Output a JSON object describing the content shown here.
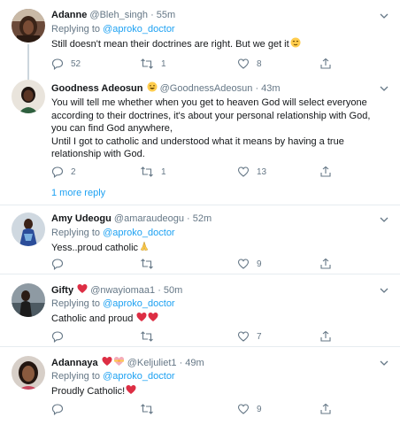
{
  "replying_prefix": "Replying to",
  "tweets": [
    {
      "name": "Adanne",
      "handle": "@Bleh_singh",
      "time": "· 55m",
      "reply_to": "@aproko_doctor",
      "text": "Still doesn't mean their doctrines are right. But we get it",
      "text_emoji": "relieved-face",
      "replies": "52",
      "retweets": "1",
      "likes": "8"
    },
    {
      "name": "Goodness Adeosun",
      "name_emoji": "grinning-face",
      "handle": "@GoodnessAdeosun",
      "time": "· 43m",
      "text_lines": [
        "You will tell me whether when you get to heaven God will select everyone",
        "according to their doctrines, it's about your personal relationship with God,",
        "you can find God anywhere,",
        "Until I got to catholic and understood what it means by having a true",
        "relationship with God."
      ],
      "replies": "2",
      "retweets": "1",
      "likes": "13"
    },
    {
      "name": "Amy Udeogu",
      "handle": "@amaraudeogu",
      "time": "· 52m",
      "reply_to": "@aproko_doctor",
      "text": "Yess..proud catholic",
      "text_emoji": "folded-hands",
      "replies": "",
      "retweets": "",
      "likes": "9"
    },
    {
      "name": "Gifty",
      "name_emoji": "red-heart",
      "handle": "@nwayiomaa1",
      "time": "· 50m",
      "reply_to": "@aproko_doctor",
      "text": "Catholic and proud",
      "text_emoji": "two-red-hearts",
      "replies": "",
      "retweets": "",
      "likes": "7"
    },
    {
      "name": "Adannaya",
      "name_emoji": "heart-and-heart-with-ribbon",
      "handle": "@Keljuliet1",
      "time": "· 49m",
      "reply_to": "@aproko_doctor",
      "text": "Proudly Catholic!",
      "text_emoji": "red-heart",
      "replies": "",
      "retweets": "",
      "likes": "9"
    }
  ],
  "more_replies_label": "1 more reply",
  "colors": {
    "link": "#1da1f2",
    "muted": "#657786",
    "text": "#14171a",
    "heart": "#e0245e",
    "divider": "#e6ecf0"
  }
}
